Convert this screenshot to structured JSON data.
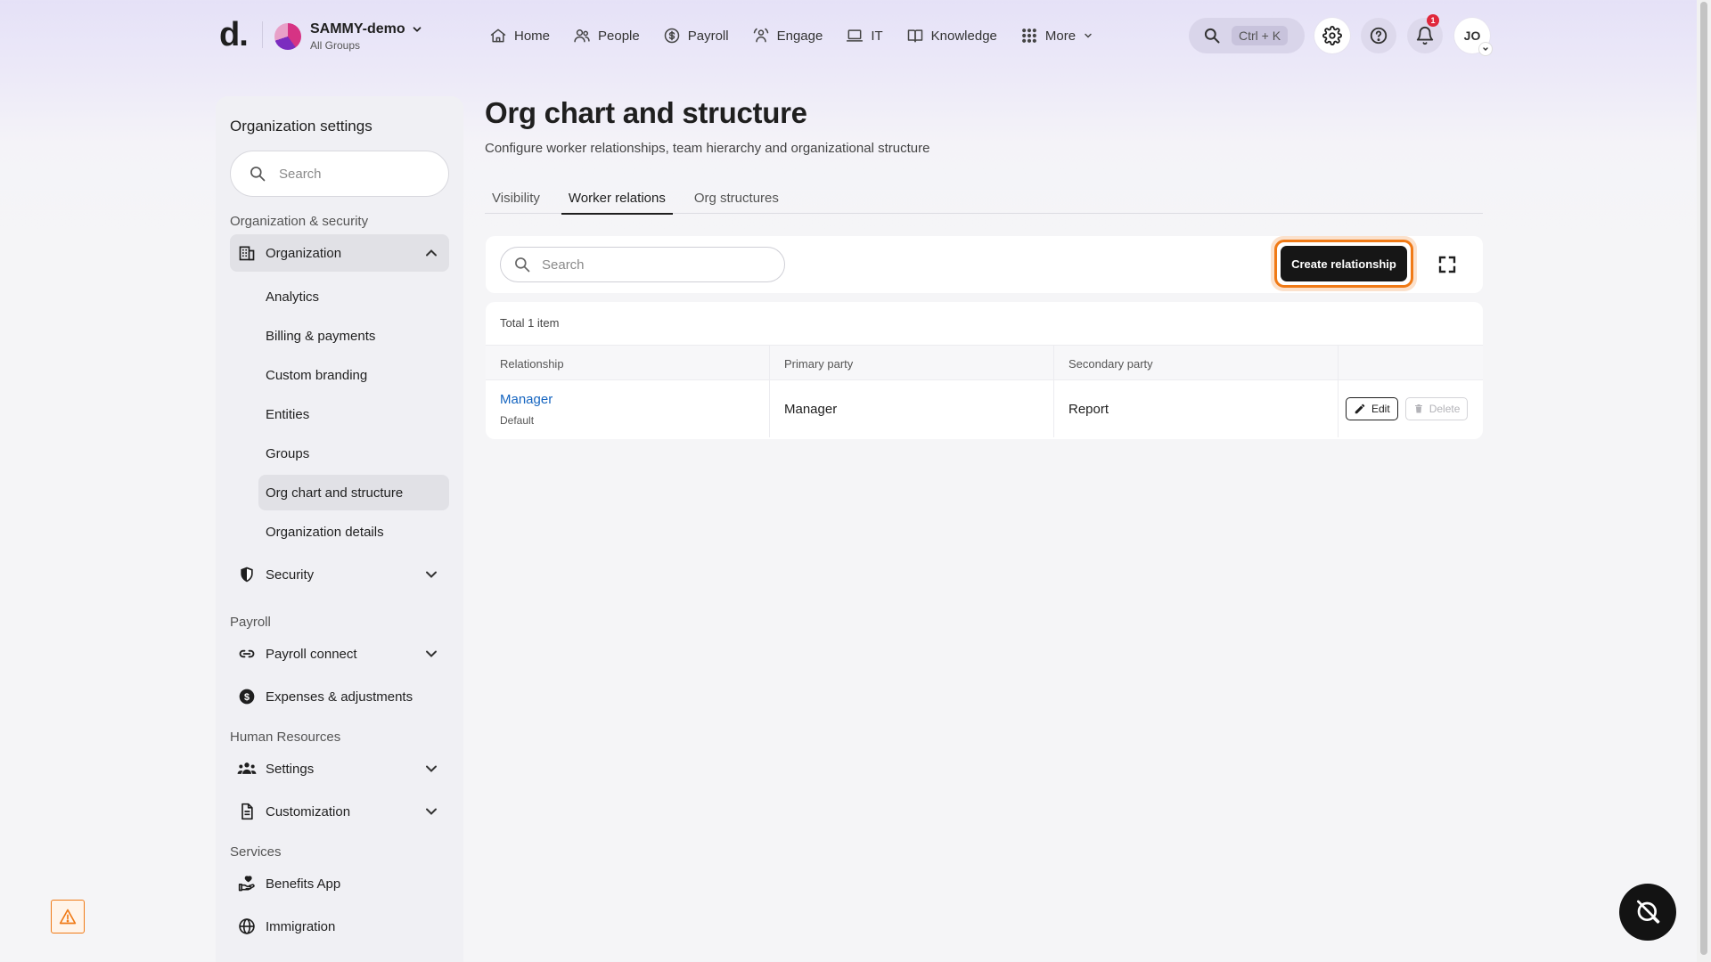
{
  "topbar": {
    "logo": "d.",
    "org_name": "SAMMY-demo",
    "org_sub": "All Groups",
    "nav": [
      {
        "label": "Home",
        "icon": "home-icon"
      },
      {
        "label": "People",
        "icon": "people-icon"
      },
      {
        "label": "Payroll",
        "icon": "payroll-icon"
      },
      {
        "label": "Engage",
        "icon": "engage-icon"
      },
      {
        "label": "IT",
        "icon": "laptop-icon"
      },
      {
        "label": "Knowledge",
        "icon": "book-icon"
      },
      {
        "label": "More",
        "icon": "grid-icon"
      }
    ],
    "search_shortcut": "Ctrl + K",
    "notification_count": "1",
    "avatar_initials": "JO"
  },
  "sidebar": {
    "title": "Organization settings",
    "search_placeholder": "Search",
    "sections": {
      "org_security": "Organization & security",
      "payroll": "Payroll",
      "hr": "Human Resources",
      "services": "Services"
    },
    "groups": {
      "organization": "Organization",
      "security": "Security",
      "payroll_connect": "Payroll connect",
      "expenses": "Expenses & adjustments",
      "settings": "Settings",
      "customization": "Customization",
      "benefits": "Benefits App",
      "immigration": "Immigration"
    },
    "org_items": [
      "Analytics",
      "Billing & payments",
      "Custom branding",
      "Entities",
      "Groups",
      "Org chart and structure",
      "Organization details"
    ],
    "active_item": "Org chart and structure"
  },
  "main": {
    "title": "Org chart and structure",
    "subtitle": "Configure worker relationships, team hierarchy and organizational structure",
    "tabs": [
      "Visibility",
      "Worker relations",
      "Org structures"
    ],
    "active_tab": "Worker relations",
    "search_placeholder": "Search",
    "create_label": "Create relationship",
    "total": "Total 1 item",
    "columns": [
      "Relationship",
      "Primary party",
      "Secondary party",
      ""
    ],
    "rows": [
      {
        "relationship": "Manager",
        "tag": "Default",
        "primary": "Manager",
        "secondary": "Report",
        "edit": "Edit",
        "delete": "Delete"
      }
    ]
  },
  "colors": {
    "accent_focus": "#f07a16",
    "link": "#1565c0",
    "primary_button": "#161616",
    "badge": "#e0283c"
  }
}
